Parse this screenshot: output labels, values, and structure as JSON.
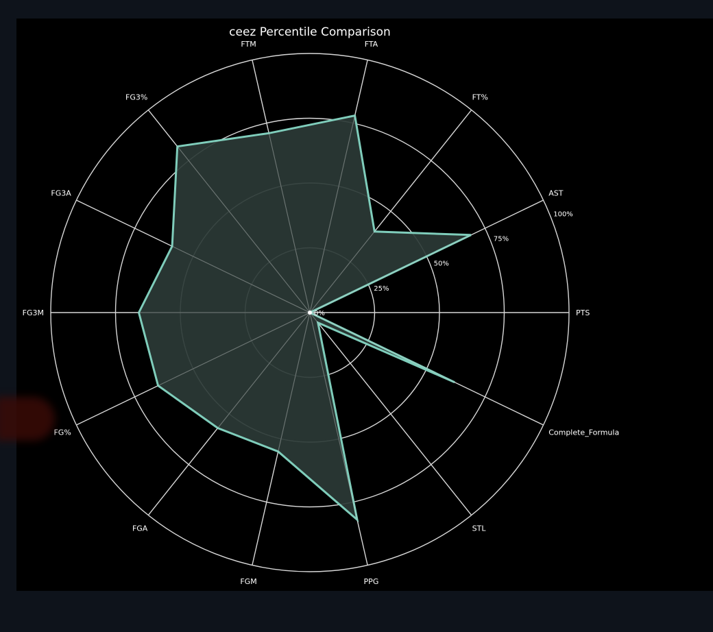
{
  "chart_data": {
    "type": "radar",
    "title": "ceez Percentile Comparison",
    "categories": [
      "PTS",
      "AST",
      "FT%",
      "FTA",
      "FTM",
      "FG3%",
      "FG3A",
      "FG3M",
      "FG%",
      "FGA",
      "FGM",
      "PPG",
      "STL",
      "Complete_Formula"
    ],
    "values": [
      0,
      69,
      40,
      78,
      71,
      82,
      59,
      66,
      65,
      57,
      55,
      82,
      5,
      62
    ],
    "radial_range": [
      0,
      100
    ],
    "radial_ticks": [
      "0%",
      "25%",
      "50%",
      "75%",
      "100%"
    ],
    "grid": true,
    "colors": {
      "background": "#000000",
      "page": "#0e131b",
      "grid": "#d8d8d8",
      "series_line": "#7fcdbb",
      "series_fill": "#2b3a36",
      "text": "#ffffff"
    }
  }
}
